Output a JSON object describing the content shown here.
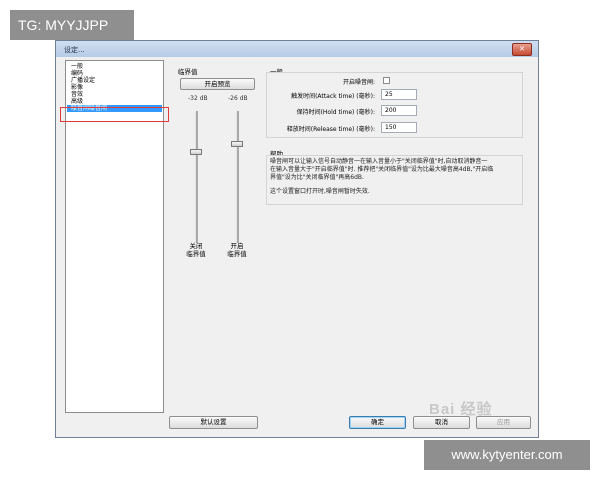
{
  "overlay": {
    "top_left_tag": "TG: MYYJJPP",
    "bottom_right_url": "www.kytyenter.com",
    "logo_watermark": "Bai 经验"
  },
  "window": {
    "title": "设定...",
    "close_label": "✕"
  },
  "sidebar": {
    "items": [
      {
        "label": "一般",
        "selected": false
      },
      {
        "label": "编码",
        "selected": false
      },
      {
        "label": "广播设定",
        "selected": false
      },
      {
        "label": "影像",
        "selected": false
      },
      {
        "label": "音效",
        "selected": false
      },
      {
        "label": "高级",
        "selected": false
      },
      {
        "label": "噪音闸噪音闸",
        "selected": true
      }
    ]
  },
  "threshold": {
    "title": "临界值",
    "preview_button": "开启预览",
    "db_left": "-32 dB",
    "db_right": "-26 dB",
    "left_slider": {
      "caption_line1": "关闭",
      "caption_line2": "临界值",
      "value_db": -32
    },
    "right_slider": {
      "caption_line1": "开启",
      "caption_line2": "临界值",
      "value_db": -26
    }
  },
  "general": {
    "title": "一般",
    "enable_label": "开启噪音闸:",
    "enable_checked": false,
    "attack_label": "触发时间(Attack time) (毫秒):",
    "attack_value": "25",
    "hold_label": "保持时间(Hold time) (毫秒):",
    "hold_value": "200",
    "release_label": "释放时间(Release time) (毫秒):",
    "release_value": "150"
  },
  "help": {
    "title": "帮助",
    "line1": "噪音闸可以让输入信号自动静音一在输入音量小于\"关闭临界值\"时,自动取消静音一",
    "line2": "在输入音量大于\"开启临界值\"时. 推荐把\"关闭临界值\"设为比最大噪音高4dB,\"开启临",
    "line3": "界值\"设为比\"关闭临界值\"再高6dB.",
    "line4": "这个设置窗口打开时,噪音闸暂时失效."
  },
  "buttons": {
    "defaults": "默认设置",
    "ok": "确定",
    "cancel": "取消",
    "apply": "应用"
  }
}
